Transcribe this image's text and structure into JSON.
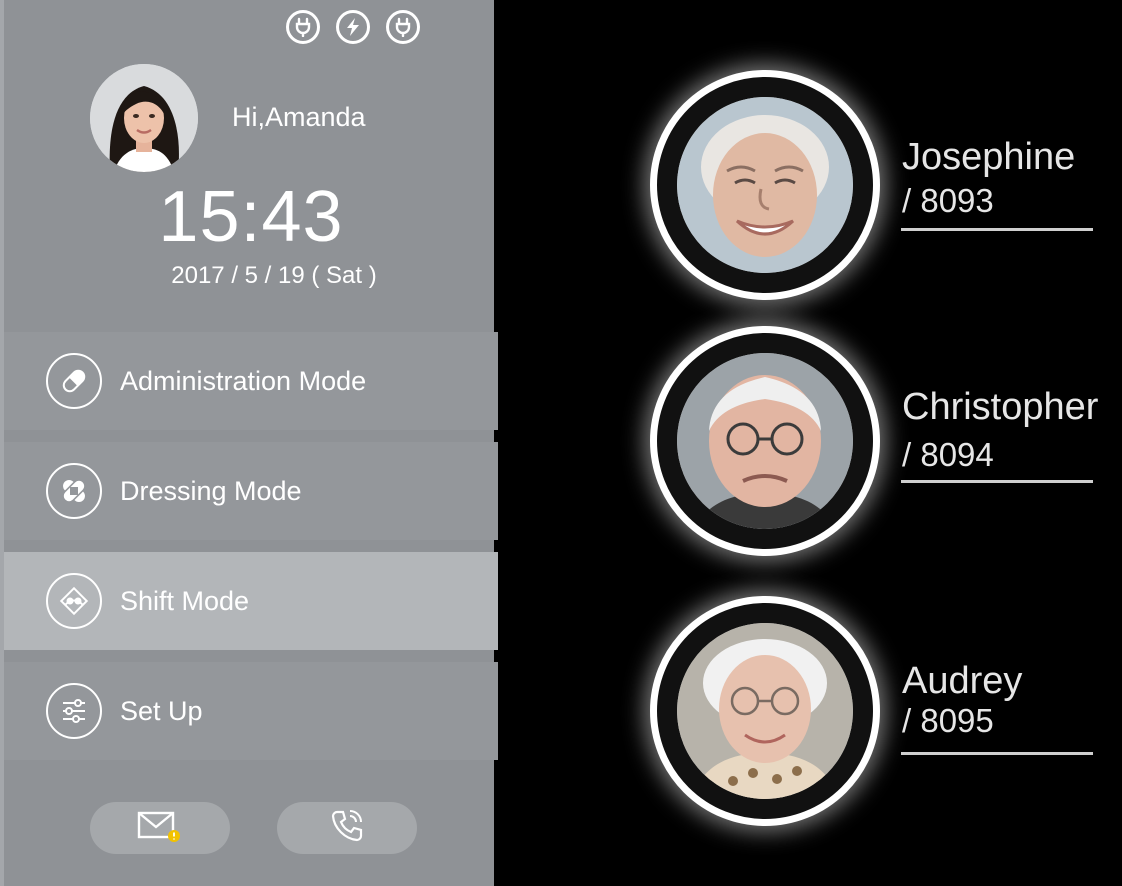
{
  "user": {
    "greeting": "Hi,Amanda"
  },
  "clock": {
    "time": "15:43",
    "date": "2017 / 5 / 19 ( Sat )"
  },
  "status_icons": [
    "plug-icon",
    "lightning-icon",
    "plug-icon"
  ],
  "menu": [
    {
      "label": "Administration Mode",
      "icon": "pill-icon"
    },
    {
      "label": "Dressing Mode",
      "icon": "bandage-icon"
    },
    {
      "label": "Shift Mode",
      "icon": "shift-icon",
      "active": true
    },
    {
      "label": "Set Up",
      "icon": "sliders-icon"
    }
  ],
  "footer": {
    "buttons": [
      "mail-alert-icon",
      "phone-icon"
    ]
  },
  "residents": [
    {
      "name": "Josephine",
      "id": "/ 8093"
    },
    {
      "name": "Christopher",
      "id": "/ 8094"
    },
    {
      "name": "Audrey",
      "id": " / 8095"
    }
  ],
  "colors": {
    "sidebar": "#8f9296",
    "menu_item": "#94979b",
    "menu_active": "#b3b6b9",
    "background": "#000000"
  }
}
